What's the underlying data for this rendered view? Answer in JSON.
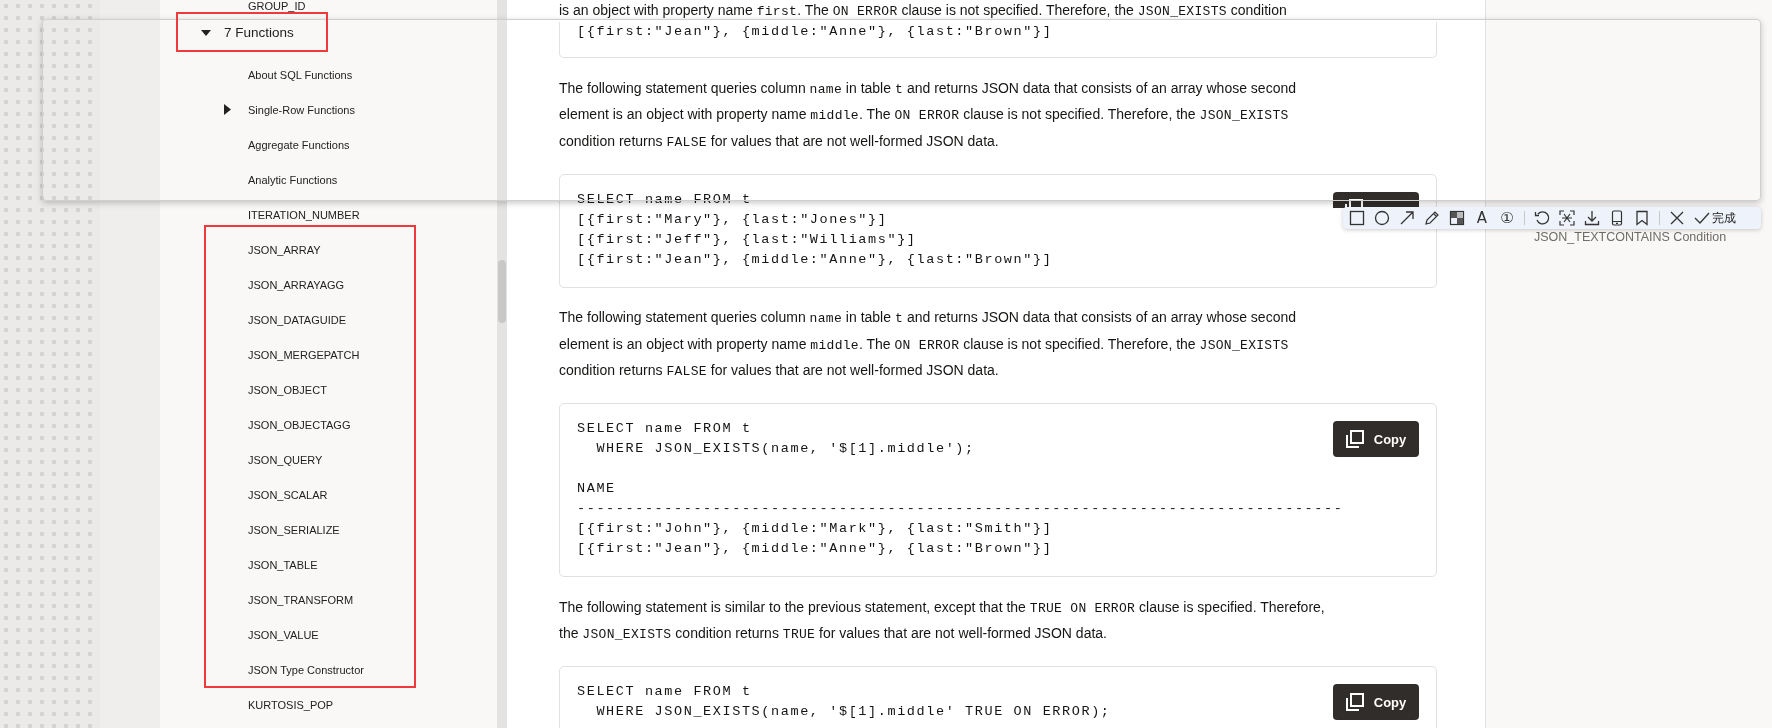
{
  "nav": {
    "items": [
      {
        "label": "GROUP_ID"
      },
      {
        "label": "7 Functions",
        "expanded": true,
        "children": [
          {
            "label": "About SQL Functions"
          },
          {
            "label": "Single-Row Functions",
            "expanded": false
          },
          {
            "label": "Aggregate Functions"
          },
          {
            "label": "Analytic Functions"
          },
          {
            "label": "ITERATION_NUMBER"
          },
          {
            "label": "JSON_ARRAY"
          },
          {
            "label": "JSON_ARRAYAGG"
          },
          {
            "label": "JSON_DATAGUIDE"
          },
          {
            "label": "JSON_MERGEPATCH"
          },
          {
            "label": "JSON_OBJECT"
          },
          {
            "label": "JSON_OBJECTAGG"
          },
          {
            "label": "JSON_QUERY"
          },
          {
            "label": "JSON_SCALAR"
          },
          {
            "label": "JSON_SERIALIZE"
          },
          {
            "label": "JSON_TABLE"
          },
          {
            "label": "JSON_TRANSFORM"
          },
          {
            "label": "JSON_VALUE"
          },
          {
            "label": "JSON Type Constructor"
          },
          {
            "label": "KURTOSIS_POP"
          }
        ]
      }
    ]
  },
  "article": {
    "blocks": [
      {
        "kind": "paragraph",
        "lines": [
          [
            {
              "t": "is an object with property name ",
              "code": false
            },
            {
              "t": "first",
              "code": true
            },
            {
              "t": ". The ",
              "code": false
            },
            {
              "t": "ON ERROR",
              "code": true
            },
            {
              "t": " clause is not specified. Therefore, the ",
              "code": false
            },
            {
              "t": "JSON_EXISTS",
              "code": true
            },
            {
              "t": " condition",
              "code": false
            }
          ]
        ]
      },
      {
        "kind": "code",
        "cut_off_top": true,
        "sections": [
          [
            "[{first:\"Jean\"}, {middle:\"Anne\"}, {last:\"Brown\"}]"
          ]
        ]
      },
      {
        "kind": "paragraph",
        "lines": [
          [
            {
              "t": "The following statement queries column ",
              "code": false
            },
            {
              "t": "name",
              "code": true
            },
            {
              "t": " in table ",
              "code": false
            },
            {
              "t": "t",
              "code": true
            },
            {
              "t": " and returns JSON data that consists of an array whose second",
              "code": false
            }
          ],
          [
            {
              "t": "element is an object with property name ",
              "code": false
            },
            {
              "t": "middle",
              "code": true
            },
            {
              "t": ". The ",
              "code": false
            },
            {
              "t": "ON ERROR",
              "code": true
            },
            {
              "t": " clause is not specified. Therefore, the ",
              "code": false
            },
            {
              "t": "JSON_EXISTS",
              "code": true
            }
          ],
          [
            {
              "t": "condition returns ",
              "code": false
            },
            {
              "t": "FALSE",
              "code": true
            },
            {
              "t": " for values that are not well-formed JSON data.",
              "code": false
            }
          ]
        ]
      },
      {
        "kind": "code",
        "cut_off_top": false,
        "copy_button": {
          "cut_off": true
        },
        "sections": [
          [
            "SELECT name FROM t",
            "[{first:\"Mary\"}, {last:\"Jones\"}]",
            "[{first:\"Jeff\"}, {last:\"Williams\"}]",
            "[{first:\"Jean\"}, {middle:\"Anne\"}, {last:\"Brown\"}]"
          ]
        ]
      },
      {
        "kind": "paragraph",
        "lines": [
          [
            {
              "t": "The following statement queries column ",
              "code": false
            },
            {
              "t": "name",
              "code": true
            },
            {
              "t": " in table ",
              "code": false
            },
            {
              "t": "t",
              "code": true
            },
            {
              "t": " and returns JSON data that consists of an array whose second",
              "code": false
            }
          ],
          [
            {
              "t": "element is an object with property name ",
              "code": false
            },
            {
              "t": "middle",
              "code": true
            },
            {
              "t": ". The ",
              "code": false
            },
            {
              "t": "ON ERROR",
              "code": true
            },
            {
              "t": " clause is not specified. Therefore, the ",
              "code": false
            },
            {
              "t": "JSON_EXISTS",
              "code": true
            }
          ],
          [
            {
              "t": "condition returns ",
              "code": false
            },
            {
              "t": "FALSE",
              "code": true
            },
            {
              "t": " for values that are not well-formed JSON data.",
              "code": false
            }
          ]
        ]
      },
      {
        "kind": "code",
        "cut_off_top": false,
        "copy_button": {
          "label": "Copy",
          "cut_off": false
        },
        "sections": [
          [
            "SELECT name FROM t",
            "  WHERE JSON_EXISTS(name, '$[1].middle');"
          ],
          [
            "NAME",
            "-------------------------------------------------------------------------------",
            "[{first:\"John\"}, {middle:\"Mark\"}, {last:\"Smith\"}]",
            "[{first:\"Jean\"}, {middle:\"Anne\"}, {last:\"Brown\"}]"
          ]
        ]
      },
      {
        "kind": "paragraph",
        "lines": [
          [
            {
              "t": "The following statement is similar to the previous statement, except that the ",
              "code": false
            },
            {
              "t": "TRUE ON ERROR",
              "code": true
            },
            {
              "t": " clause is specified. Therefore,",
              "code": false
            }
          ],
          [
            {
              "t": "the ",
              "code": false
            },
            {
              "t": "JSON_EXISTS",
              "code": true
            },
            {
              "t": " condition returns ",
              "code": false
            },
            {
              "t": "TRUE",
              "code": true
            },
            {
              "t": " for values that are not well-formed JSON data.",
              "code": false
            }
          ]
        ]
      },
      {
        "kind": "code",
        "cut_off_top": false,
        "copy_button": {
          "label": "Copy",
          "cut_off": false
        },
        "sections": [
          [
            "SELECT name FROM t",
            "  WHERE JSON_EXISTS(name, '$[1].middle' TRUE ON ERROR);"
          ]
        ]
      }
    ]
  },
  "rail": {
    "links": [
      "JSON_TEXTCONTAINS Condition"
    ]
  },
  "capture_toolbar": {
    "tools": [
      {
        "kind": "rectangle"
      },
      {
        "kind": "ellipse"
      },
      {
        "kind": "arrow"
      },
      {
        "kind": "pencil"
      },
      {
        "kind": "mosaic"
      },
      {
        "kind": "text",
        "glyph": "A"
      },
      {
        "kind": "number",
        "glyph": "①"
      },
      {
        "kind": "separator"
      },
      {
        "kind": "undo"
      },
      {
        "kind": "ocr"
      },
      {
        "kind": "download"
      },
      {
        "kind": "phone"
      },
      {
        "kind": "pin"
      },
      {
        "kind": "separator"
      },
      {
        "kind": "close"
      },
      {
        "kind": "done",
        "label": "完成"
      }
    ]
  }
}
